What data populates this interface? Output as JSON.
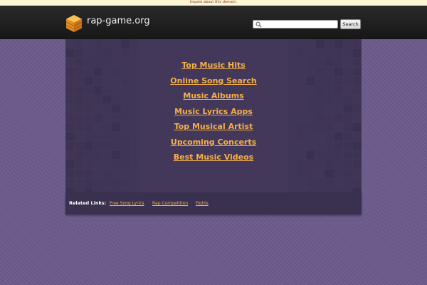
{
  "top_notice": {
    "text": "Inquire about this domain."
  },
  "header": {
    "site_name": "rap-game.org",
    "search": {
      "value": "",
      "placeholder": "",
      "button_label": "Search"
    }
  },
  "main_links": [
    "Top Music Hits",
    "Online Song Search",
    "Music Albums",
    "Music Lyrics Apps",
    "Top Musical Artist",
    "Upcoming Concerts",
    "Best Music Videos"
  ],
  "related": {
    "title": "Related Links:",
    "links": [
      "Free Song Lyrics",
      "Rap Competition",
      "Fights"
    ]
  },
  "colors": {
    "link": "#f5b04a",
    "header_bg": "#1f1f1f",
    "panel_bg": "#433859",
    "page_bg": "#6b5b8c",
    "logo": "#f0a630"
  },
  "icons": {
    "logo": "stacked-cube-icon",
    "search": "search-icon"
  }
}
